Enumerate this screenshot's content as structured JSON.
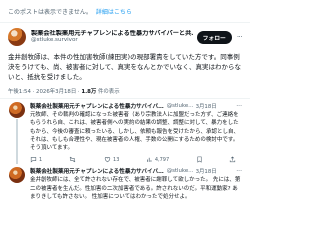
{
  "notice": {
    "text": "このポストは表示できません。",
    "link": "詳細はこちら"
  },
  "main_tweet": {
    "display_name": "製薬会社製薬用元チャプレンによる性暴力サバイバーと共…",
    "handle": "@stluke.survivor",
    "follow_label": "フォロー",
    "body": "金井創牧師は、本件の性加害牧師(練田実)の現部署責をしていた方です。同事例決をうけても、尚、被害者に対して、真実をなんとかでいなく、真実はわからないと、抵抗を受けました。",
    "meta_time": "午後1:54 · 2026年3月18日 · ",
    "views_count": "1.8万",
    "views_label": " 件の表示"
  },
  "replies": [
    {
      "name": "製薬会社製薬用元チャプレンによる性暴力サバイバ…",
      "handle": "@stluke…",
      "date": "3月18日",
      "text": "元牧師、その裁判の確認になった被害者（あり宗教法人に加盟だった方ず、ご連絡をもらうれら自、これは、被害者側への実約の結果の調整、調整に対して、暴力をしたもから、今後の審査に頼ったいる、しかし、依頼も報告を受けたから、承認とし自、それは、もしも合理性や、現在被害者の人権、手数の公開にするための検討中です。そう頂いてます。",
      "reply_count": "1",
      "repost_count": "",
      "like_count": "13",
      "views": "4,797"
    },
    {
      "name": "製薬会社製薬用元チャプレンによる性暴力サバイバ…",
      "handle": "@stluke…",
      "date": "3月18日",
      "text": "金井創牧師には、全て許されない存在で、被害者に謝罪して欲しかった。 先には、第二の被害者を生んだ。性加害の二次加害者である。許されないのだ。平和運動家? あまりきしても許さない。 性加害についてはわかったで処分せよ。",
      "reply_count": "",
      "repost_count": "",
      "like_count": "",
      "views": ""
    }
  ],
  "colors": {
    "accent": "#1d9bf0",
    "text": "#0f1419",
    "muted": "#536471"
  },
  "icons": {
    "reply": "comment-icon",
    "repost": "repost-icon",
    "like": "heart-icon",
    "views": "views-icon",
    "bookmark": "bookmark-icon",
    "share": "share-icon"
  }
}
